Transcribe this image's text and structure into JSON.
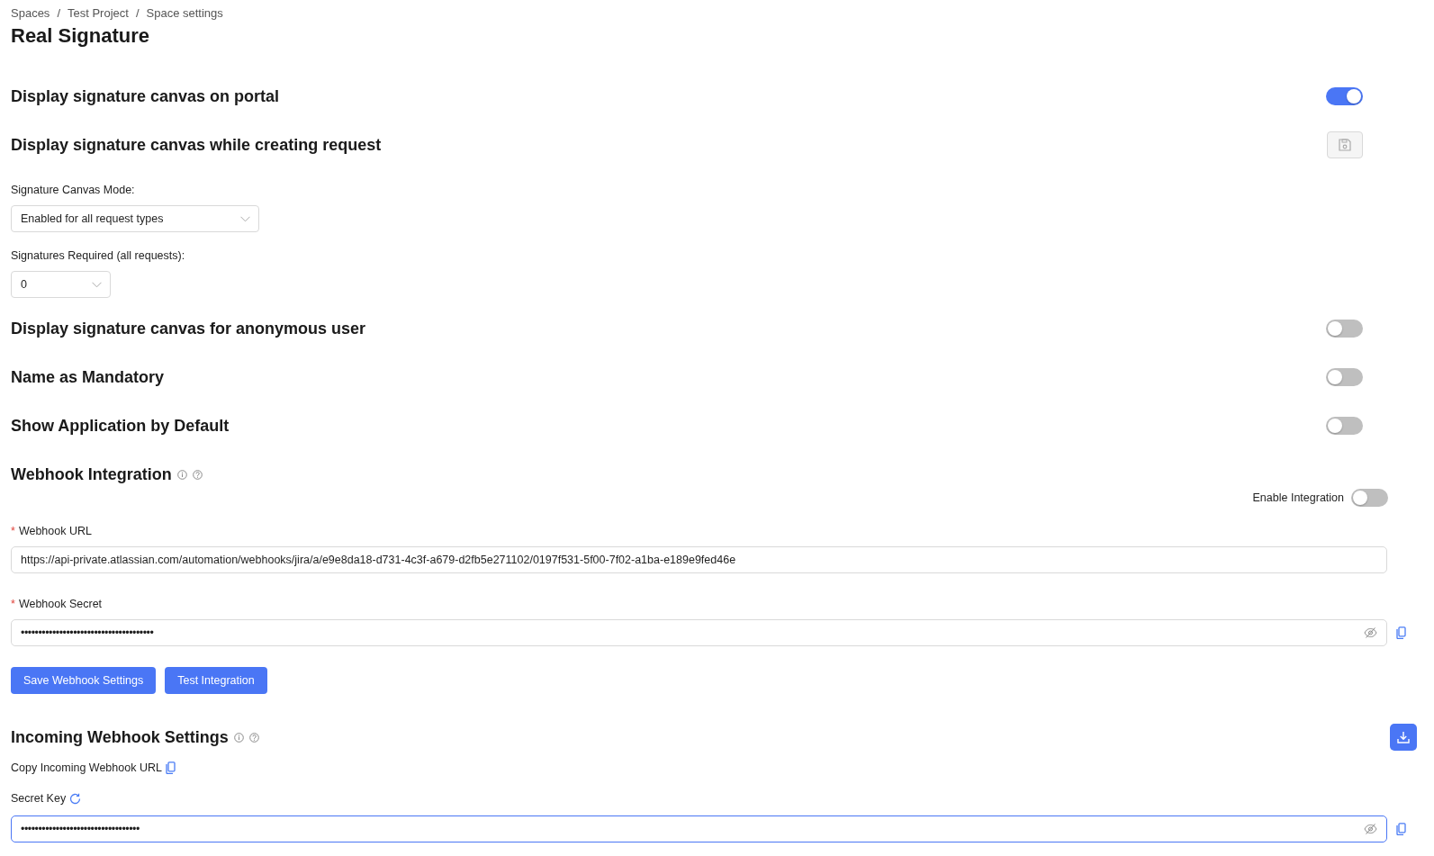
{
  "breadcrumbs": [
    {
      "label": "Spaces",
      "separator": "/"
    },
    {
      "label": "Test Project",
      "separator": "/"
    },
    {
      "label": "Space settings"
    }
  ],
  "page_title": "Real Signature",
  "settings": [
    {
      "kind": "toggle",
      "title": "Display signature canvas on portal",
      "on": true
    },
    {
      "kind": "save",
      "title": "Display signature canvas while creating request",
      "disabled": true
    },
    {
      "kind": "select",
      "label": "Signature Canvas Mode:",
      "value": "Enabled for all request types"
    },
    {
      "kind": "select",
      "label": "Signatures Required (all requests):",
      "value": "0"
    },
    {
      "kind": "toggle",
      "title": "Display signature canvas for anonymous user",
      "on": false
    },
    {
      "kind": "toggle",
      "title": "Name as Mandatory",
      "on": false
    },
    {
      "kind": "toggle",
      "title": "Show Application by Default",
      "on": false
    }
  ],
  "webhook": {
    "title": "Webhook Integration",
    "enable_label": "Enable Integration",
    "enabled": false,
    "fields": [
      {
        "kind": "text",
        "required_mark": "*",
        "label": "Webhook URL",
        "value": "https://api-private.atlassian.com/automation/webhooks/jira/a/e9e8da18-d731-4c3f-a679-d2fb5e271102/0197f531-5f00-7f02-a1ba-e189e9fed46e",
        "focused": false
      },
      {
        "kind": "secret",
        "required_mark": "*",
        "label": "Webhook Secret",
        "value": "••••••••••••••••••••••••••••••••••••••",
        "focused": false
      }
    ],
    "buttons": [
      "Save Webhook Settings",
      "Test Integration"
    ]
  },
  "incoming": {
    "title": "Incoming Webhook Settings",
    "copy_label": "Copy Incoming Webhook URL",
    "secret_label": "Secret Key",
    "secret_field": {
      "kind": "secret",
      "value": "••••••••••••••••••••••••••••••••••",
      "focused": true
    }
  }
}
